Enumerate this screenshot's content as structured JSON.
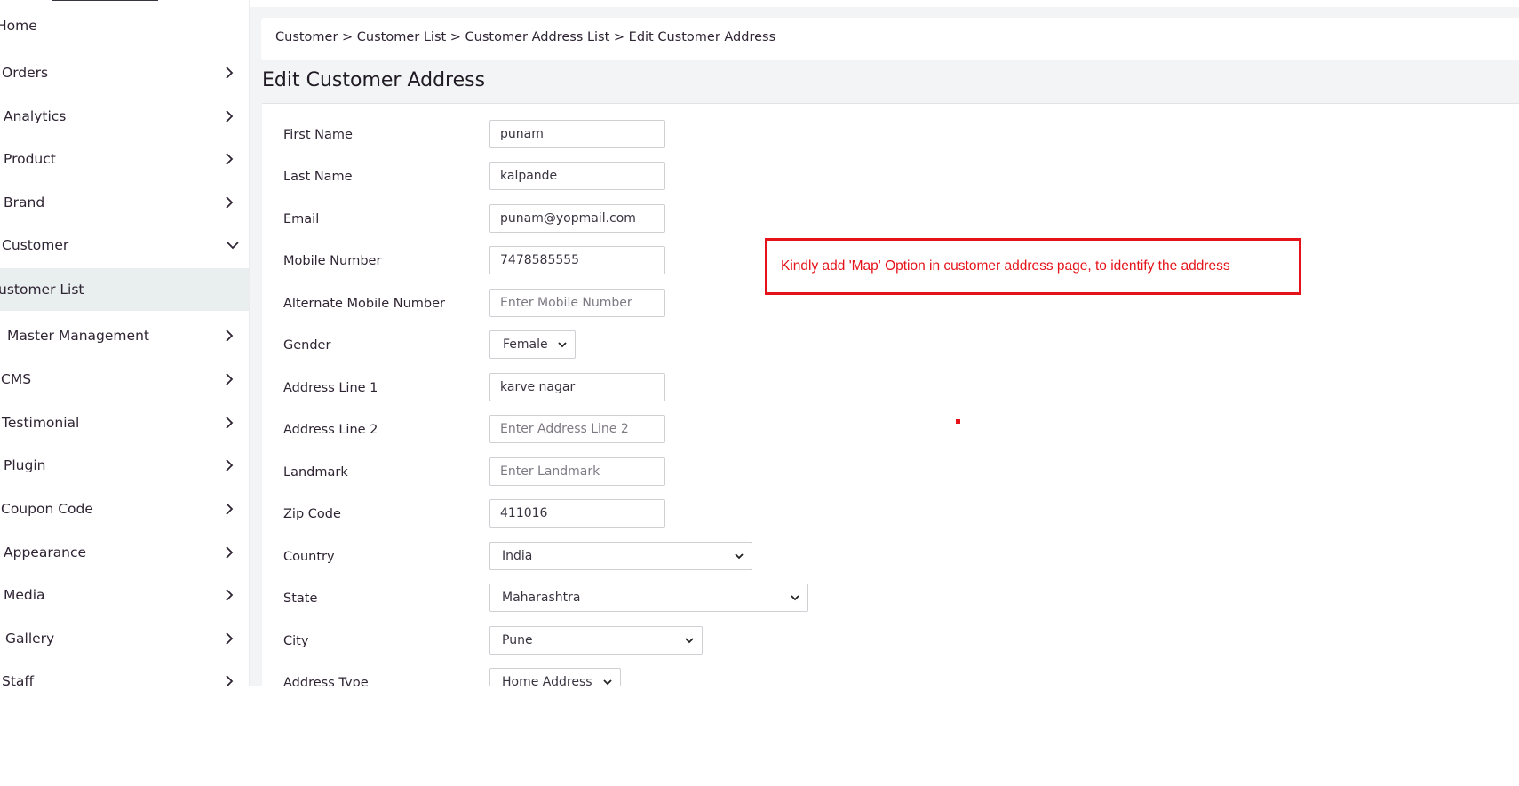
{
  "sidebar": {
    "items": [
      {
        "label": "Home"
      },
      {
        "label": "Orders"
      },
      {
        "label": "Analytics"
      },
      {
        "label": "Product"
      },
      {
        "label": "Brand"
      },
      {
        "label": "Customer"
      },
      {
        "label": "ustomer List"
      },
      {
        "label": "Master Management"
      },
      {
        "label": "CMS"
      },
      {
        "label": "Testimonial"
      },
      {
        "label": "Plugin"
      },
      {
        "label": "Coupon Code"
      },
      {
        "label": "Appearance"
      },
      {
        "label": "Media"
      },
      {
        "label": "Gallery"
      },
      {
        "label": "Staff"
      }
    ]
  },
  "breadcrumb": "Customer > Customer List > Customer Address List > Edit Customer Address",
  "page_title": "Edit Customer Address",
  "form": {
    "first_name": {
      "label": "First Name",
      "value": "punam"
    },
    "last_name": {
      "label": "Last Name",
      "value": "kalpande"
    },
    "email": {
      "label": "Email",
      "value": "punam@yopmail.com"
    },
    "mobile": {
      "label": "Mobile Number",
      "value": "7478585555"
    },
    "alt_mobile": {
      "label": "Alternate Mobile Number",
      "value": "",
      "placeholder": "Enter Mobile Number"
    },
    "gender": {
      "label": "Gender",
      "value": "Female"
    },
    "address1": {
      "label": "Address Line 1",
      "value": "karve nagar"
    },
    "address2": {
      "label": "Address Line 2",
      "value": "",
      "placeholder": "Enter Address Line 2"
    },
    "landmark": {
      "label": "Landmark",
      "value": "",
      "placeholder": "Enter Landmark"
    },
    "zip": {
      "label": "Zip Code",
      "value": "411016"
    },
    "country": {
      "label": "Country",
      "value": "India"
    },
    "state": {
      "label": "State",
      "value": "Maharashtra"
    },
    "city": {
      "label": "City",
      "value": "Pune"
    },
    "address_type": {
      "label": "Address Type",
      "value": "Home Address"
    }
  },
  "annotation": {
    "text": "Kindly add 'Map' Option in customer address page, to identify the address",
    "color": "#e5121a"
  },
  "colors": {
    "sidebar_active_bg": "#e8efee",
    "main_bg": "#f2f4f5",
    "text": "#2f2433"
  }
}
